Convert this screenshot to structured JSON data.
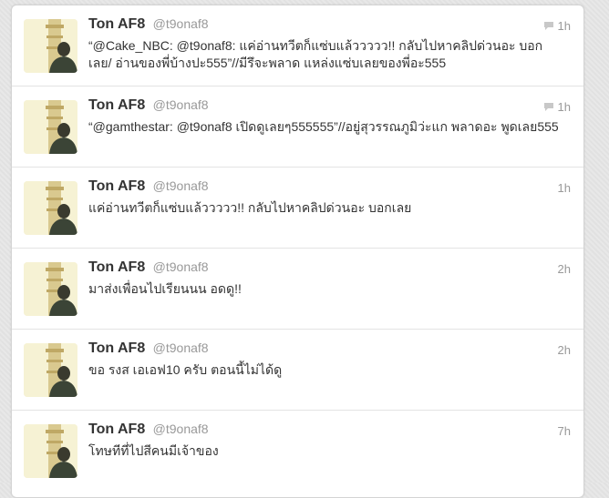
{
  "tweets": [
    {
      "name": "Ton AF8",
      "handle": "@t9onaf8",
      "time": "1h",
      "has_reply_icon": true,
      "text": "“@Cake_NBC: @t9onaf8: แค่อ่านทวีตก็แซ่บแล้ววววว!! กลับไปหาคลิปด่วนอะ บอกเลย/ อ่านของพี่บ้างปะ555”//มีรึจะพลาด แหล่งแซ่บเลยของพี่อะ555"
    },
    {
      "name": "Ton AF8",
      "handle": "@t9onaf8",
      "time": "1h",
      "has_reply_icon": true,
      "text": "“@gamthestar: @t9onaf8 เปิดดูเลยๆ555555”//อยู่สุวรรณภูมิว่ะแก พลาดอะ พูดเลย555"
    },
    {
      "name": "Ton AF8",
      "handle": "@t9onaf8",
      "time": "1h",
      "has_reply_icon": false,
      "text": "แค่อ่านทวีตก็แซ่บแล้ววววว!! กลับไปหาคลิปด่วนอะ บอกเลย"
    },
    {
      "name": "Ton AF8",
      "handle": "@t9onaf8",
      "time": "2h",
      "has_reply_icon": false,
      "text": "มาส่งเพื่อนไปเรียนนน อดดู!!"
    },
    {
      "name": "Ton AF8",
      "handle": "@t9onaf8",
      "time": "2h",
      "has_reply_icon": false,
      "text": "ขอ รงส เอเอฟ10 ครับ ตอนนี้ไม่ได้ดู"
    },
    {
      "name": "Ton AF8",
      "handle": "@t9onaf8",
      "time": "7h",
      "has_reply_icon": false,
      "text": "โทษทีที่ไปสีคนมีเจ้าของ"
    }
  ],
  "colors": {
    "name": "#333333",
    "muted": "#999999",
    "background": "#e6e6e6"
  }
}
